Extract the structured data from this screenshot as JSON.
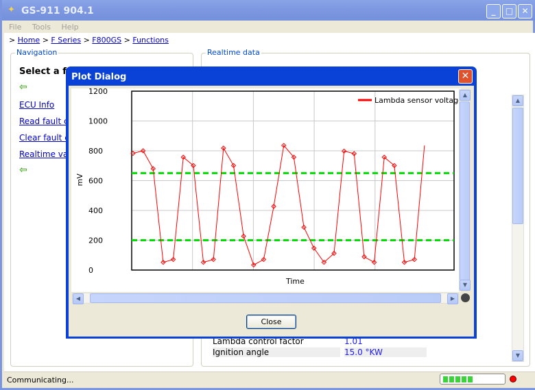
{
  "window": {
    "title": "GS-911 904.1",
    "min": "_",
    "max": "□",
    "close": "✕"
  },
  "menu": [
    "File",
    "Tools",
    "Help"
  ],
  "breadcrumb": [
    ">",
    "Home",
    ">",
    "F Series",
    ">",
    "F800GS",
    ">",
    "Functions"
  ],
  "navigation": {
    "label": "Navigation",
    "heading": "Select a fu",
    "items": [
      "ECU Info",
      "Read fault c",
      "Clear fault c",
      "Realtime val"
    ],
    "arrow_icon": "green-left-arrow"
  },
  "realtime": {
    "label": "Realtime data",
    "rows": [
      {
        "name": "Lambda control factor",
        "value": "1.01"
      },
      {
        "name": "Ignition angle",
        "value": "15.0 °KW"
      }
    ]
  },
  "status": {
    "text": "Communicating...",
    "progress_segments": 5,
    "indicator_color": "#ff0000"
  },
  "dialog": {
    "title": "Plot Dialog",
    "close_label": "Close"
  },
  "chart_data": {
    "type": "line",
    "xlabel": "Time",
    "ylabel": "mV",
    "ylim": [
      0,
      1200
    ],
    "yticks": [
      "0",
      "200",
      "400",
      "600",
      "800",
      "1000",
      "1200"
    ],
    "grid": true,
    "legend": "top-right",
    "series": [
      {
        "name": "Lambda sensor voltage",
        "color": "#ff0000",
        "markers": "diamond",
        "values": [
          783,
          800,
          680,
          52,
          71,
          757,
          701,
          52,
          71,
          818,
          701,
          227,
          34,
          71,
          427,
          836,
          757,
          287,
          147,
          52,
          112,
          798,
          781,
          89,
          52,
          757,
          701,
          52,
          71,
          836
        ]
      }
    ],
    "thresholds": [
      {
        "value": 650,
        "color": "#00dd00",
        "style": "dashed"
      },
      {
        "value": 200,
        "color": "#00dd00",
        "style": "dashed"
      }
    ]
  }
}
